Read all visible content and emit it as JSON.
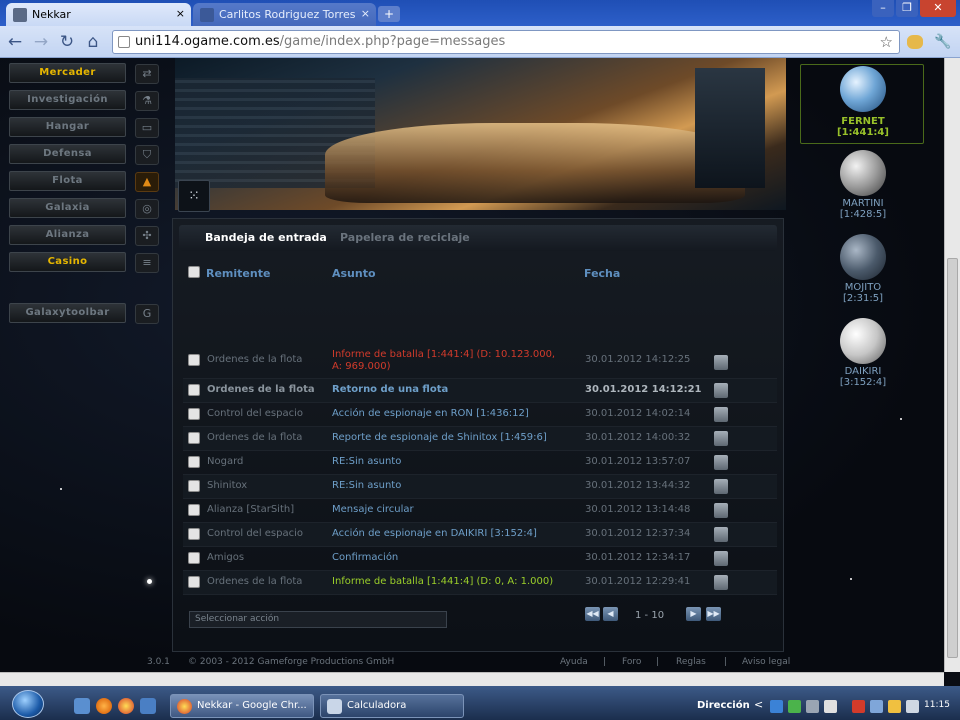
{
  "browser": {
    "tabs": [
      {
        "label": "Nekkar",
        "active": true,
        "icon": "ogame-icon"
      },
      {
        "label": "Carlitos Rodriguez Torres",
        "active": false,
        "icon": "facebook-icon"
      }
    ],
    "close_glyph": "×",
    "new_tab_glyph": "+",
    "window_buttons": [
      "–",
      "❐",
      "✕"
    ],
    "nav_glyphs": {
      "back": "←",
      "forward": "→",
      "reload": "↻",
      "home": "⌂",
      "star": "☆",
      "wrench": "🔧"
    },
    "url_host": "uni114.ogame.com.es",
    "url_path": "/game/index.php?page=messages"
  },
  "sidebar": {
    "menu": [
      {
        "label": "Mercader",
        "highlight": true,
        "icon": "⇄"
      },
      {
        "label": "Investigación",
        "highlight": false,
        "icon": "⚗"
      },
      {
        "label": "Hangar",
        "highlight": false,
        "icon": "▭"
      },
      {
        "label": "Defensa",
        "highlight": false,
        "icon": "⛉"
      },
      {
        "label": "Flota",
        "highlight": false,
        "icon": "▲"
      },
      {
        "label": "Galaxia",
        "highlight": false,
        "icon": "◎"
      },
      {
        "label": "Alianza",
        "highlight": false,
        "icon": "✣"
      },
      {
        "label": "Casino",
        "highlight": true,
        "icon": "≡"
      }
    ],
    "toolbar_item": {
      "label": "Galaxytoolbar",
      "icon": "G"
    }
  },
  "banner_icon": "⁙",
  "messages": {
    "tabs": [
      "Bandeja de entrada",
      "Papelera de reciclaje"
    ],
    "columns": {
      "sender": "Remitente",
      "subject": "Asunto",
      "date": "Fecha"
    },
    "rows": [
      {
        "sender": "Ordenes de la flota",
        "subject": "Informe de batalla [1:441:4] (D: 10.123.000,",
        "subject2": "A: 969.000)",
        "date": "30.01.2012 14:12:25",
        "style": "red",
        "unread": false
      },
      {
        "sender": "Ordenes de la flota",
        "subject": "Retorno de una flota",
        "date": "30.01.2012 14:12:21",
        "style": "normal",
        "unread": true
      },
      {
        "sender": "Control del espacio",
        "subject": "Acción de espionaje en RON [1:436:12]",
        "date": "30.01.2012 14:02:14",
        "style": "normal",
        "unread": false
      },
      {
        "sender": "Ordenes de la flota",
        "subject": "Reporte de espionaje de Shinitox [1:459:6]",
        "date": "30.01.2012 14:00:32",
        "style": "normal",
        "unread": false
      },
      {
        "sender": "Nogard",
        "subject": "RE:Sin asunto",
        "date": "30.01.2012 13:57:07",
        "style": "normal",
        "unread": false
      },
      {
        "sender": "Shinitox",
        "subject": "RE:Sin asunto",
        "date": "30.01.2012 13:44:32",
        "style": "normal",
        "unread": false
      },
      {
        "sender": "Alianza [StarSith]",
        "subject": "Mensaje circular",
        "date": "30.01.2012 13:14:48",
        "style": "normal",
        "unread": false
      },
      {
        "sender": "Control del espacio",
        "subject": "Acción de espionaje en DAIKIRI [3:152:4]",
        "date": "30.01.2012 12:37:34",
        "style": "normal",
        "unread": false
      },
      {
        "sender": "Amigos",
        "subject": "Confirmación",
        "date": "30.01.2012 12:34:17",
        "style": "normal",
        "unread": false
      },
      {
        "sender": "Ordenes de la flota",
        "subject": "Informe de batalla [1:441:4] (D: 0, A: 1.000)",
        "date": "30.01.2012 12:29:41",
        "style": "green",
        "unread": false
      }
    ],
    "action_placeholder": "Seleccionar acción",
    "pager": {
      "range": "1 - 10",
      "first": "◀◀",
      "prev": "◀",
      "next": "▶",
      "last": "▶▶"
    }
  },
  "planets": [
    {
      "name": "FERNET",
      "coords": "[1:441:4]",
      "active": true
    },
    {
      "name": "MARTINI",
      "coords": "[1:428:5]",
      "active": false
    },
    {
      "name": "MOJITO",
      "coords": "[2:31:5]",
      "active": false
    },
    {
      "name": "DAIKIRI",
      "coords": "[3:152:4]",
      "active": false
    }
  ],
  "footer": {
    "version": "3.0.1",
    "copyright": "© 2003 - 2012 Gameforge Productions GmbH",
    "links": [
      "Ayuda",
      "Foro",
      "Reglas",
      "Aviso legal"
    ],
    "separator": "|"
  },
  "taskbar": {
    "tasks": [
      "Nekkar - Google Chr...",
      "Calculadora"
    ],
    "address_label": "Dirección",
    "tray_arrow": "<",
    "clock": "11:15"
  },
  "colors": {
    "accent_gold": "#e6b600",
    "link_blue": "#6e9fc9",
    "battle_red": "#d23b2b",
    "battle_green": "#9bcf2a",
    "planet_active": "#98c12a"
  }
}
